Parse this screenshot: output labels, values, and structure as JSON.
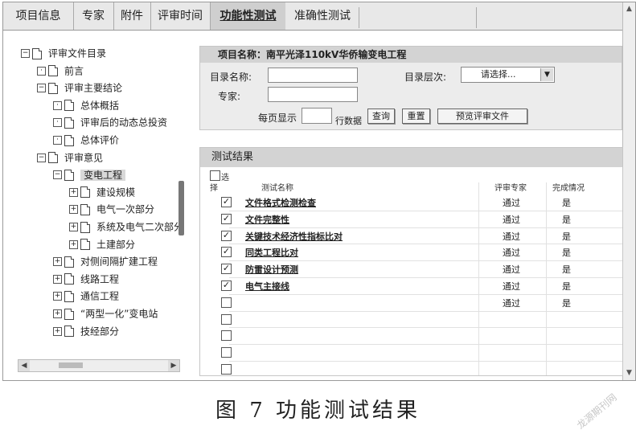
{
  "tabs": [
    {
      "label": "项目信息",
      "active": false
    },
    {
      "label": "专家",
      "active": false
    },
    {
      "label": "附件",
      "active": false
    },
    {
      "label": "评审时间",
      "active": false
    },
    {
      "label": "功能性测试",
      "active": true
    },
    {
      "label": "准确性测试",
      "active": false
    }
  ],
  "tree": [
    {
      "label": "评审文件目录",
      "toggle": "⊟",
      "level": 0
    },
    {
      "label": "前言",
      "toggle": "·",
      "level": 1
    },
    {
      "label": "评审主要结论",
      "toggle": "⊟",
      "level": 1
    },
    {
      "label": "总体概括",
      "toggle": "·",
      "level": 2
    },
    {
      "label": "评审后的动态总投资",
      "toggle": "·",
      "level": 2
    },
    {
      "label": "总体评价",
      "toggle": "·",
      "level": 2
    },
    {
      "label": "评审意见",
      "toggle": "⊟",
      "level": 1
    },
    {
      "label": "变电工程",
      "toggle": "⊟",
      "level": 2,
      "selected": true
    },
    {
      "label": "建设规模",
      "toggle": "⊞",
      "level": 3
    },
    {
      "label": "电气一次部分",
      "toggle": "⊞",
      "level": 3
    },
    {
      "label": "系统及电气二次部分",
      "toggle": "⊞",
      "level": 3
    },
    {
      "label": "土建部分",
      "toggle": "⊞",
      "level": 3
    },
    {
      "label": "对侧间隔扩建工程",
      "toggle": "⊞",
      "level": 2
    },
    {
      "label": "线路工程",
      "toggle": "⊞",
      "level": 2
    },
    {
      "label": "通信工程",
      "toggle": "⊞",
      "level": 2
    },
    {
      "label": "“两型一化”变电站",
      "toggle": "⊞",
      "level": 2
    },
    {
      "label": "技经部分",
      "toggle": "⊞",
      "level": 2
    }
  ],
  "query": {
    "project_title": "项目名称：南平光泽110kV华侨输变电工程",
    "dir_name_label": "目录名称:",
    "dir_level_label": "目录层次:",
    "dir_level_value": "请选择...",
    "expert_label": "专家:",
    "per_page_label": "每页显示",
    "per_page_suffix": "行数据",
    "query_btn": "查询",
    "reset_btn": "重置",
    "preview_btn": "预览评审文件"
  },
  "results": {
    "title": "测试结果",
    "select_all_label": "选",
    "col_select": "择",
    "col_name": "测试名称",
    "col_expert": "评审专家",
    "col_status": "完成情况",
    "rows": [
      {
        "checked": true,
        "name": "文件格式检测检查",
        "expert": "通过",
        "status": "是"
      },
      {
        "checked": true,
        "name": "文件完整性",
        "expert": "通过",
        "status": "是"
      },
      {
        "checked": true,
        "name": "关键技术经济性指标比对",
        "expert": "通过",
        "status": "是"
      },
      {
        "checked": true,
        "name": "同类工程比对",
        "expert": "通过",
        "status": "是"
      },
      {
        "checked": true,
        "name": "防雷设计预测",
        "expert": "通过",
        "status": "是"
      },
      {
        "checked": true,
        "name": "电气主接线",
        "expert": "通过",
        "status": "是"
      },
      {
        "checked": false,
        "name": "",
        "expert": "通过",
        "status": "是"
      },
      {
        "checked": false,
        "name": "",
        "expert": "",
        "status": ""
      },
      {
        "checked": false,
        "name": "",
        "expert": "",
        "status": ""
      },
      {
        "checked": false,
        "name": "",
        "expert": "",
        "status": ""
      },
      {
        "checked": false,
        "name": "",
        "expert": "",
        "status": ""
      }
    ]
  },
  "caption": "图 7   功能测试结果",
  "watermark": "龙源期刊网"
}
